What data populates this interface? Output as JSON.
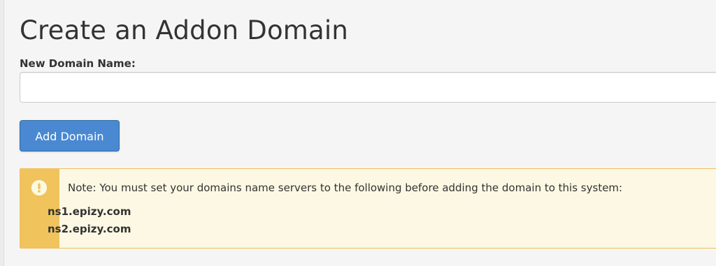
{
  "page": {
    "title": "Create an Addon Domain"
  },
  "form": {
    "domain_label": "New Domain Name:",
    "domain_value": "",
    "domain_placeholder": "",
    "submit_label": "Add Domain"
  },
  "notice": {
    "icon": "exclamation-circle-icon",
    "text": "Note: You must set your domains name servers to the following before adding the domain to this system:",
    "nameservers": [
      "ns1.epizy.com",
      "ns2.epizy.com"
    ]
  },
  "colors": {
    "button_bg": "#4a89d1",
    "notice_accent": "#f0c35c",
    "notice_bg": "#fcf8e3"
  }
}
